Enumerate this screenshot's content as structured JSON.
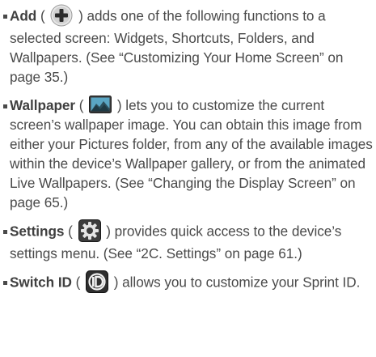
{
  "items": [
    {
      "term": "Add",
      "open": " ( ",
      "icon": "plus-circle-icon",
      "close": " ) adds one of the following functions to a selected screen: Widgets, Shortcuts, Folders, and Wallpapers. (See “Customizing Your Home Screen” on page 35.)"
    },
    {
      "term": "Wallpaper",
      "open": " ( ",
      "icon": "wallpaper-icon",
      "close": " ) lets you to customize the current screen’s wallpaper image. You can obtain this image from either your Pictures folder, from any of the available images within the device’s Wallpaper gallery, or from the animated Live Wallpapers. (See “Changing the Display Screen” on page 65.)"
    },
    {
      "term": "Settings",
      "open": " ( ",
      "icon": "settings-gear-icon",
      "close": " ) provides quick access to the device’s settings menu. (See “2C. Settings” on page 61.)"
    },
    {
      "term": "Switch ID",
      "open": " ( ",
      "icon": "sprint-id-icon",
      "close": " ) allows you to customize your Sprint ID."
    }
  ]
}
